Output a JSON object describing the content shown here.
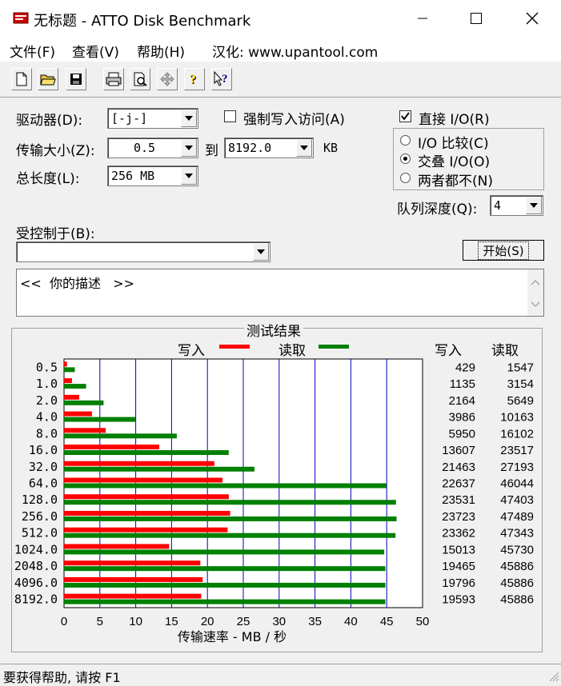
{
  "window": {
    "title": "无标题 - ATTO Disk Benchmark",
    "minimize_icon": "minimize-icon",
    "maximize_icon": "maximize-icon",
    "close_icon": "close-icon"
  },
  "menu": {
    "items": [
      "文件(F)",
      "查看(V)",
      "帮助(H)",
      "汉化: www.upantool.com"
    ]
  },
  "toolbar": {
    "icons": [
      "new-file-icon",
      "open-folder-icon",
      "save-icon",
      "print-icon",
      "print-preview-icon",
      "move-icon",
      "help-icon",
      "context-help-icon"
    ]
  },
  "settings": {
    "drive_label": "驱动器(D):",
    "drive_value": "[-j-]",
    "force_write_label": "强制写入访问(A)",
    "force_write_checked": false,
    "transfer_label": "传输大小(Z):",
    "transfer_from": "0.5",
    "to_label": "到",
    "transfer_to": "8192.0",
    "kb_label": "KB",
    "total_label": "总长度(L):",
    "total_value": "256 MB",
    "direct_io_label": "直接 I/O(R)",
    "direct_io_checked": true,
    "radio_options": [
      "I/O 比较(C)",
      "交叠 I/O(O)",
      "两者都不(N)"
    ],
    "radio_selected": 1,
    "queue_label": "队列深度(Q):",
    "queue_value": "4",
    "controlled_label": "受控制于(B):",
    "controlled_value": "",
    "start_button": "开始(S)",
    "description": "<<  你的描述   >>"
  },
  "results": {
    "group_title": "测试结果",
    "legend_write": "写入",
    "legend_read": "读取",
    "col_write": "写入",
    "col_read": "读取",
    "xlabel": "传输速率 - MB / 秒",
    "write_color": "#ff0000",
    "read_color": "#008000"
  },
  "chart_data": {
    "type": "bar",
    "orientation": "horizontal",
    "categories": [
      "0.5",
      "1.0",
      "2.0",
      "4.0",
      "8.0",
      "16.0",
      "32.0",
      "64.0",
      "128.0",
      "256.0",
      "512.0",
      "1024.0",
      "2048.0",
      "4096.0",
      "8192.0"
    ],
    "series": [
      {
        "name": "写入",
        "color": "#ff0000",
        "values": [
          429,
          1135,
          2164,
          3986,
          5950,
          13607,
          21463,
          22637,
          23531,
          23723,
          23362,
          15013,
          19465,
          19796,
          19593
        ]
      },
      {
        "name": "读取",
        "color": "#008000",
        "values": [
          1547,
          3154,
          5649,
          10163,
          16102,
          23517,
          27193,
          46044,
          47403,
          47489,
          47343,
          45730,
          45886,
          45886,
          45886
        ]
      }
    ],
    "write_values": [
      "429",
      "1135",
      "2164",
      "3986",
      "5950",
      "13607",
      "21463",
      "22637",
      "23531",
      "23723",
      "23362",
      "15013",
      "19465",
      "19796",
      "19593"
    ],
    "read_values": [
      "1547",
      "3154",
      "5649",
      "10163",
      "16102",
      "23517",
      "27193",
      "46044",
      "47403",
      "47489",
      "47343",
      "45730",
      "45886",
      "45886",
      "45886"
    ],
    "xticks": [
      "0",
      "5",
      "10",
      "15",
      "20",
      "25",
      "30",
      "35",
      "40",
      "45",
      "50"
    ],
    "xlim": [
      0,
      50
    ],
    "xlabel": "传输速率 - MB / 秒",
    "grid": true,
    "legend": "top"
  },
  "status": {
    "text": "要获得帮助, 请按 F1"
  }
}
